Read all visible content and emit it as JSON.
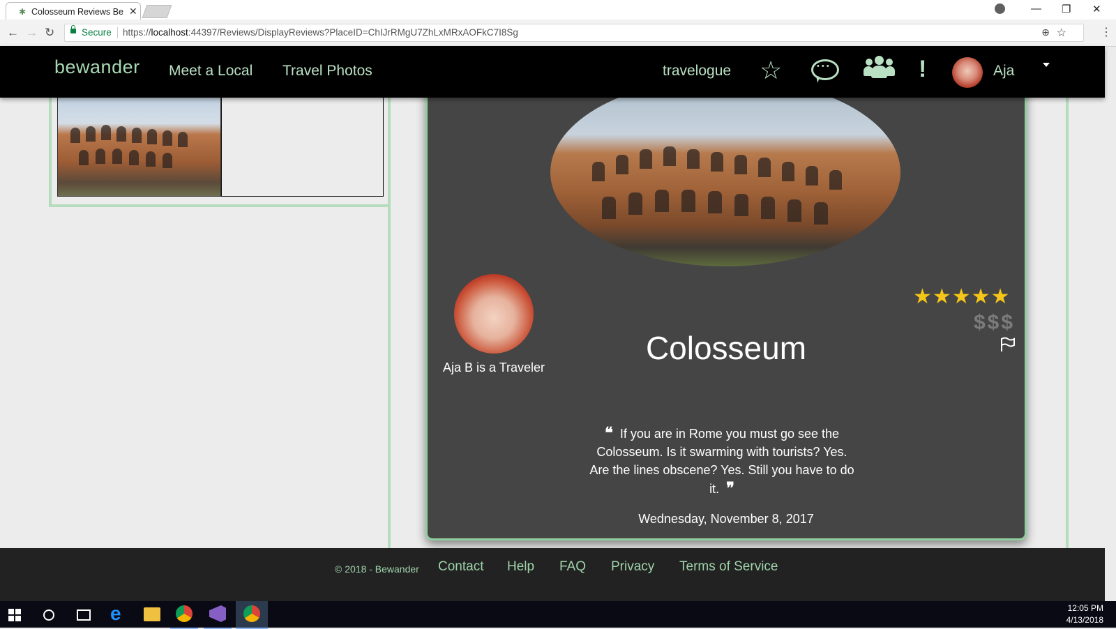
{
  "browser": {
    "tab_title": "Colosseum Reviews Bewander",
    "secure_label": "Secure",
    "url_scheme": "https://",
    "url_host": "localhost",
    "url_rest": ":44397/Reviews/DisplayReviews?PlaceID=ChIJrRMgU7ZhLxMRxAOFkC7I8Sg"
  },
  "header": {
    "brand": "bewander",
    "nav": [
      {
        "label": "Meet a Local"
      },
      {
        "label": "Travel Photos"
      }
    ],
    "travelogue": "travelogue",
    "user_name": "Aja"
  },
  "review": {
    "reviewer_caption": "Aja B is a Traveler",
    "place_name": "Colosseum",
    "rating_stars": "★★★★★",
    "rating": 5,
    "price_level": "$$$",
    "text": "If you are in Rome you must go see the Colosseum. Is it swarming with tourists? Yes. Are the lines obscene? Yes. Still you have to do it.",
    "date": "Wednesday, November 8, 2017"
  },
  "footer": {
    "copyright": "© 2018 - Bewander",
    "links": [
      {
        "label": "Contact"
      },
      {
        "label": "Help"
      },
      {
        "label": "FAQ"
      },
      {
        "label": "Privacy"
      },
      {
        "label": "Terms of Service"
      }
    ]
  },
  "taskbar": {
    "time": "12:05 PM",
    "date": "4/13/2018"
  },
  "colors": {
    "header_bg": "#000000",
    "accent_green": "#b9e0c3",
    "card_bg": "#454545",
    "star_gold": "#f5c518",
    "footer_bg": "#222222"
  }
}
